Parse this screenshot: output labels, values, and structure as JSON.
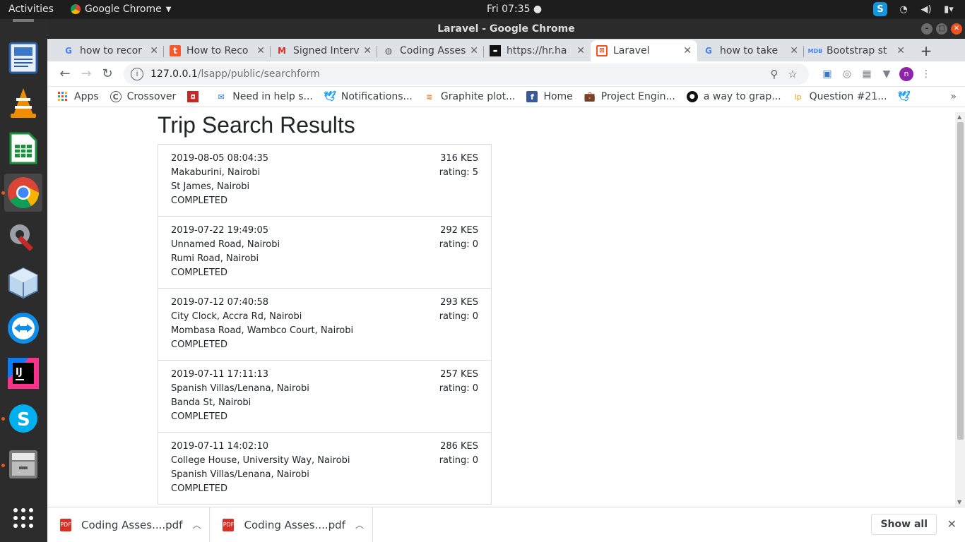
{
  "topbar": {
    "activities": "Activities",
    "app_name": "Google Chrome",
    "clock": "Fri 07:35 ●"
  },
  "window": {
    "title": "Laravel - Google Chrome"
  },
  "tabs": [
    {
      "label": "how to recor",
      "icon": "google-icon"
    },
    {
      "label": "How to Reco",
      "icon": "t-icon"
    },
    {
      "label": "Signed Interv",
      "icon": "gmail-icon"
    },
    {
      "label": "Coding Asses",
      "icon": "globe-icon"
    },
    {
      "label": "https://hr.ha",
      "icon": "hackerrank-icon"
    },
    {
      "label": "Laravel",
      "icon": "laravel-icon",
      "active": true
    },
    {
      "label": "how to take",
      "icon": "google-icon"
    },
    {
      "label": "Bootstrap st",
      "icon": "mdb-icon"
    }
  ],
  "address": {
    "host": "127.0.0.1",
    "path": "/lsapp/public/searchform"
  },
  "profile_initial": "n",
  "bookmarks": [
    {
      "label": "Apps",
      "icon": "apps-grid-icon"
    },
    {
      "label": "Crossover",
      "icon": "crossover-icon"
    },
    {
      "label": "",
      "icon": "red-bookmark-icon"
    },
    {
      "label": "Need in help s...",
      "icon": "mail-icon"
    },
    {
      "label": "Notifications...",
      "icon": "twitter-icon"
    },
    {
      "label": "Graphite plot...",
      "icon": "stackoverflow-icon"
    },
    {
      "label": "Home",
      "icon": "facebook-icon"
    },
    {
      "label": "Project Engin...",
      "icon": "briefcase-icon"
    },
    {
      "label": "a way to grap...",
      "icon": "github-icon"
    },
    {
      "label": "Question #21...",
      "icon": "launchpad-icon"
    },
    {
      "label": "",
      "icon": "twitter-icon"
    }
  ],
  "page": {
    "title": "Trip Search Results",
    "trips": [
      {
        "date": "2019-08-05 08:04:35",
        "from": "Makaburini, Nairobi",
        "to": "St James, Nairobi",
        "status": "COMPLETED",
        "cost": "316 KES",
        "rating": "rating: 5"
      },
      {
        "date": "2019-07-22 19:49:05",
        "from": "Unnamed Road, Nairobi",
        "to": "Rumi Road, Nairobi",
        "status": "COMPLETED",
        "cost": "292 KES",
        "rating": "rating: 0"
      },
      {
        "date": "2019-07-12 07:40:58",
        "from": "City Clock, Accra Rd, Nairobi",
        "to": "Mombasa Road, Wambco Court, Nairobi",
        "status": "COMPLETED",
        "cost": "293 KES",
        "rating": "rating: 0"
      },
      {
        "date": "2019-07-11 17:11:13",
        "from": "Spanish Villas/Lenana, Nairobi",
        "to": "Banda St, Nairobi",
        "status": "COMPLETED",
        "cost": "257 KES",
        "rating": "rating: 0"
      },
      {
        "date": "2019-07-11 14:02:10",
        "from": "College House, University Way, Nairobi",
        "to": "Spanish Villas/Lenana, Nairobi",
        "status": "COMPLETED",
        "cost": "286 KES",
        "rating": "rating: 0"
      }
    ]
  },
  "downloads": {
    "items": [
      {
        "label": "Coding Asses....pdf"
      },
      {
        "label": "Coding Asses....pdf"
      }
    ],
    "show_all": "Show all"
  }
}
